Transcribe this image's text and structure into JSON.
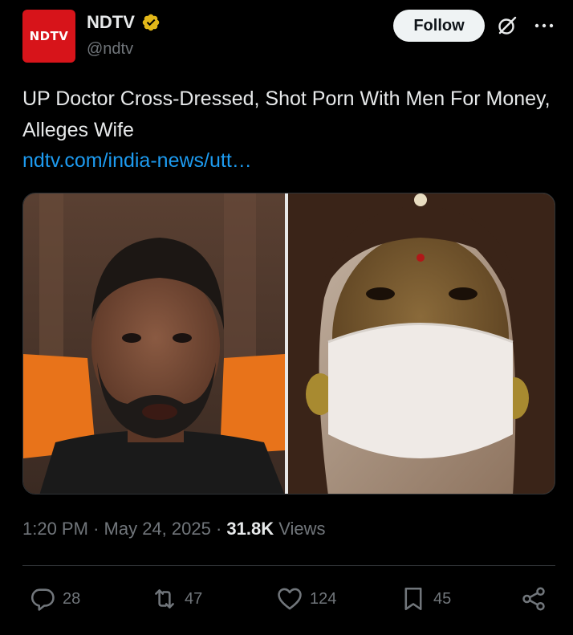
{
  "author": {
    "avatar_text": "NDTV",
    "display_name": "NDTV",
    "handle": "@ndtv",
    "verified_color": "#e2b719"
  },
  "header": {
    "follow_label": "Follow"
  },
  "post": {
    "text": "UP Doctor Cross-Dressed, Shot Porn With Men For Money, Alleges Wife",
    "link": "ndtv.com/india-news/utt…"
  },
  "meta": {
    "time": "1:20 PM",
    "separator": "·",
    "date": "May 24, 2025",
    "views_count": "31.8K",
    "views_label": "Views"
  },
  "actions": {
    "replies": "28",
    "reposts": "47",
    "likes": "124",
    "bookmarks": "45"
  },
  "colors": {
    "background": "#000000",
    "text": "#e7e9ea",
    "muted": "#71767b",
    "link": "#1d9bf0",
    "brand_red": "#d7141a"
  }
}
